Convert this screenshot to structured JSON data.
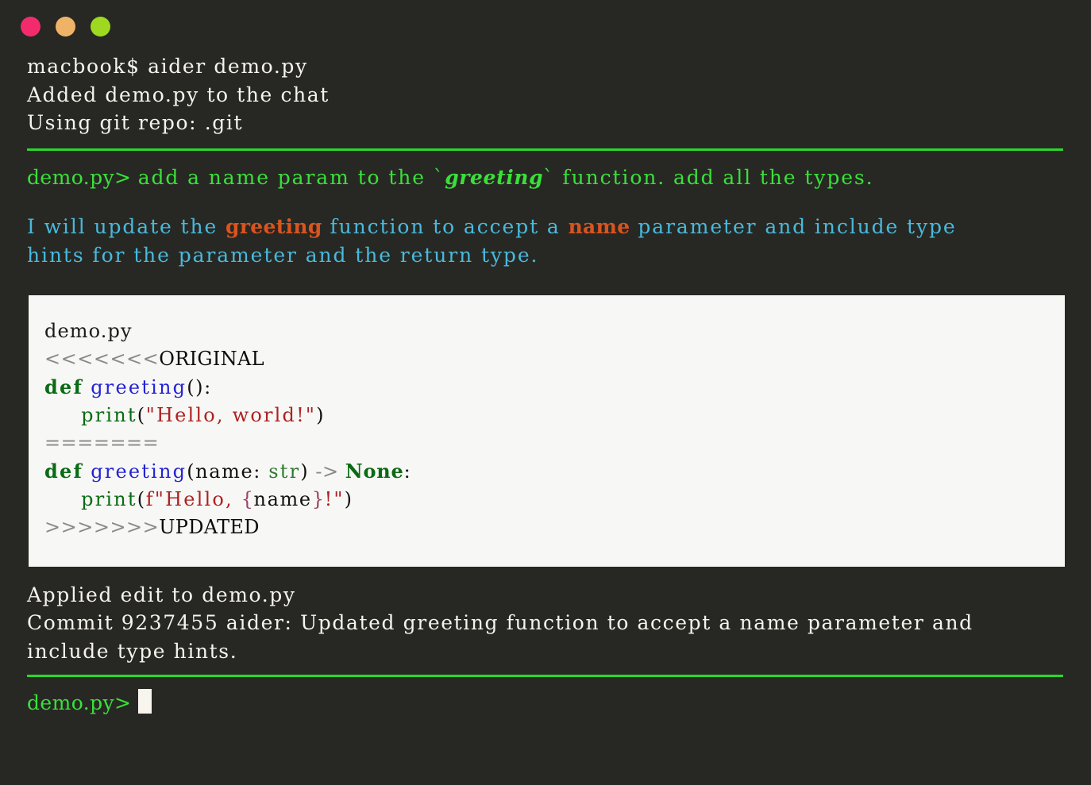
{
  "window": {
    "traffic_lights": [
      {
        "name": "close-button",
        "color": "#f42a6f"
      },
      {
        "name": "minimize-button",
        "color": "#efb368"
      },
      {
        "name": "maximize-button",
        "color": "#9ed91f"
      }
    ]
  },
  "theme": {
    "background": "#272823",
    "foreground": "#f5f3ec",
    "prompt_green": "#3ae03a",
    "rule_green": "#2ad82a",
    "assistant_cyan": "#49b9dd",
    "highlight_orange": "#d9541f",
    "code_bg": "#f7f7f5",
    "cursor": "#f7f5ee"
  },
  "session": {
    "shell_lines": [
      "macbook$ aider demo.py",
      "Added demo.py to the chat",
      "Using git repo: .git"
    ],
    "user_prompt": {
      "prefix": "demo.py> ",
      "before": "add a name param to the `",
      "emphasis": "greeting",
      "after": "` function. add all the types."
    },
    "assistant_reply": {
      "seg1": "I will update the ",
      "hl1": "greeting",
      "seg2": " function to accept a ",
      "hl2": "name",
      "seg3": " parameter and include type\nhints for the parameter and the return type."
    },
    "code_block": {
      "filename": "demo.py",
      "marker_original": "<<<<<<<",
      "label_original": "ORIGINAL",
      "separator": "=======",
      "marker_updated": ">>>>>>>",
      "label_updated": "UPDATED",
      "original": {
        "kw": "def",
        "fn": "greeting",
        "sig": "():",
        "call": "print",
        "open_paren": "(",
        "string": "\"Hello, world!\"",
        "close_paren": ")"
      },
      "updated": {
        "kw": "def",
        "fn": "greeting",
        "paren_open": "(",
        "param": "name: ",
        "type": "str",
        "paren_close": ")",
        "arrow": " -> ",
        "rettype": "None",
        "colon": ":",
        "call": "print",
        "call_open": "(",
        "fstr_a": "f\"Hello, ",
        "brace_open": "{",
        "var": "name",
        "brace_close": "}",
        "fstr_b": "!\"",
        "call_close": ")"
      }
    },
    "result_lines": [
      "Applied edit to demo.py",
      "Commit 9237455 aider: Updated greeting function to accept a name parameter and\ninclude type hints."
    ],
    "final_prompt": {
      "prefix": "demo.py>"
    }
  }
}
